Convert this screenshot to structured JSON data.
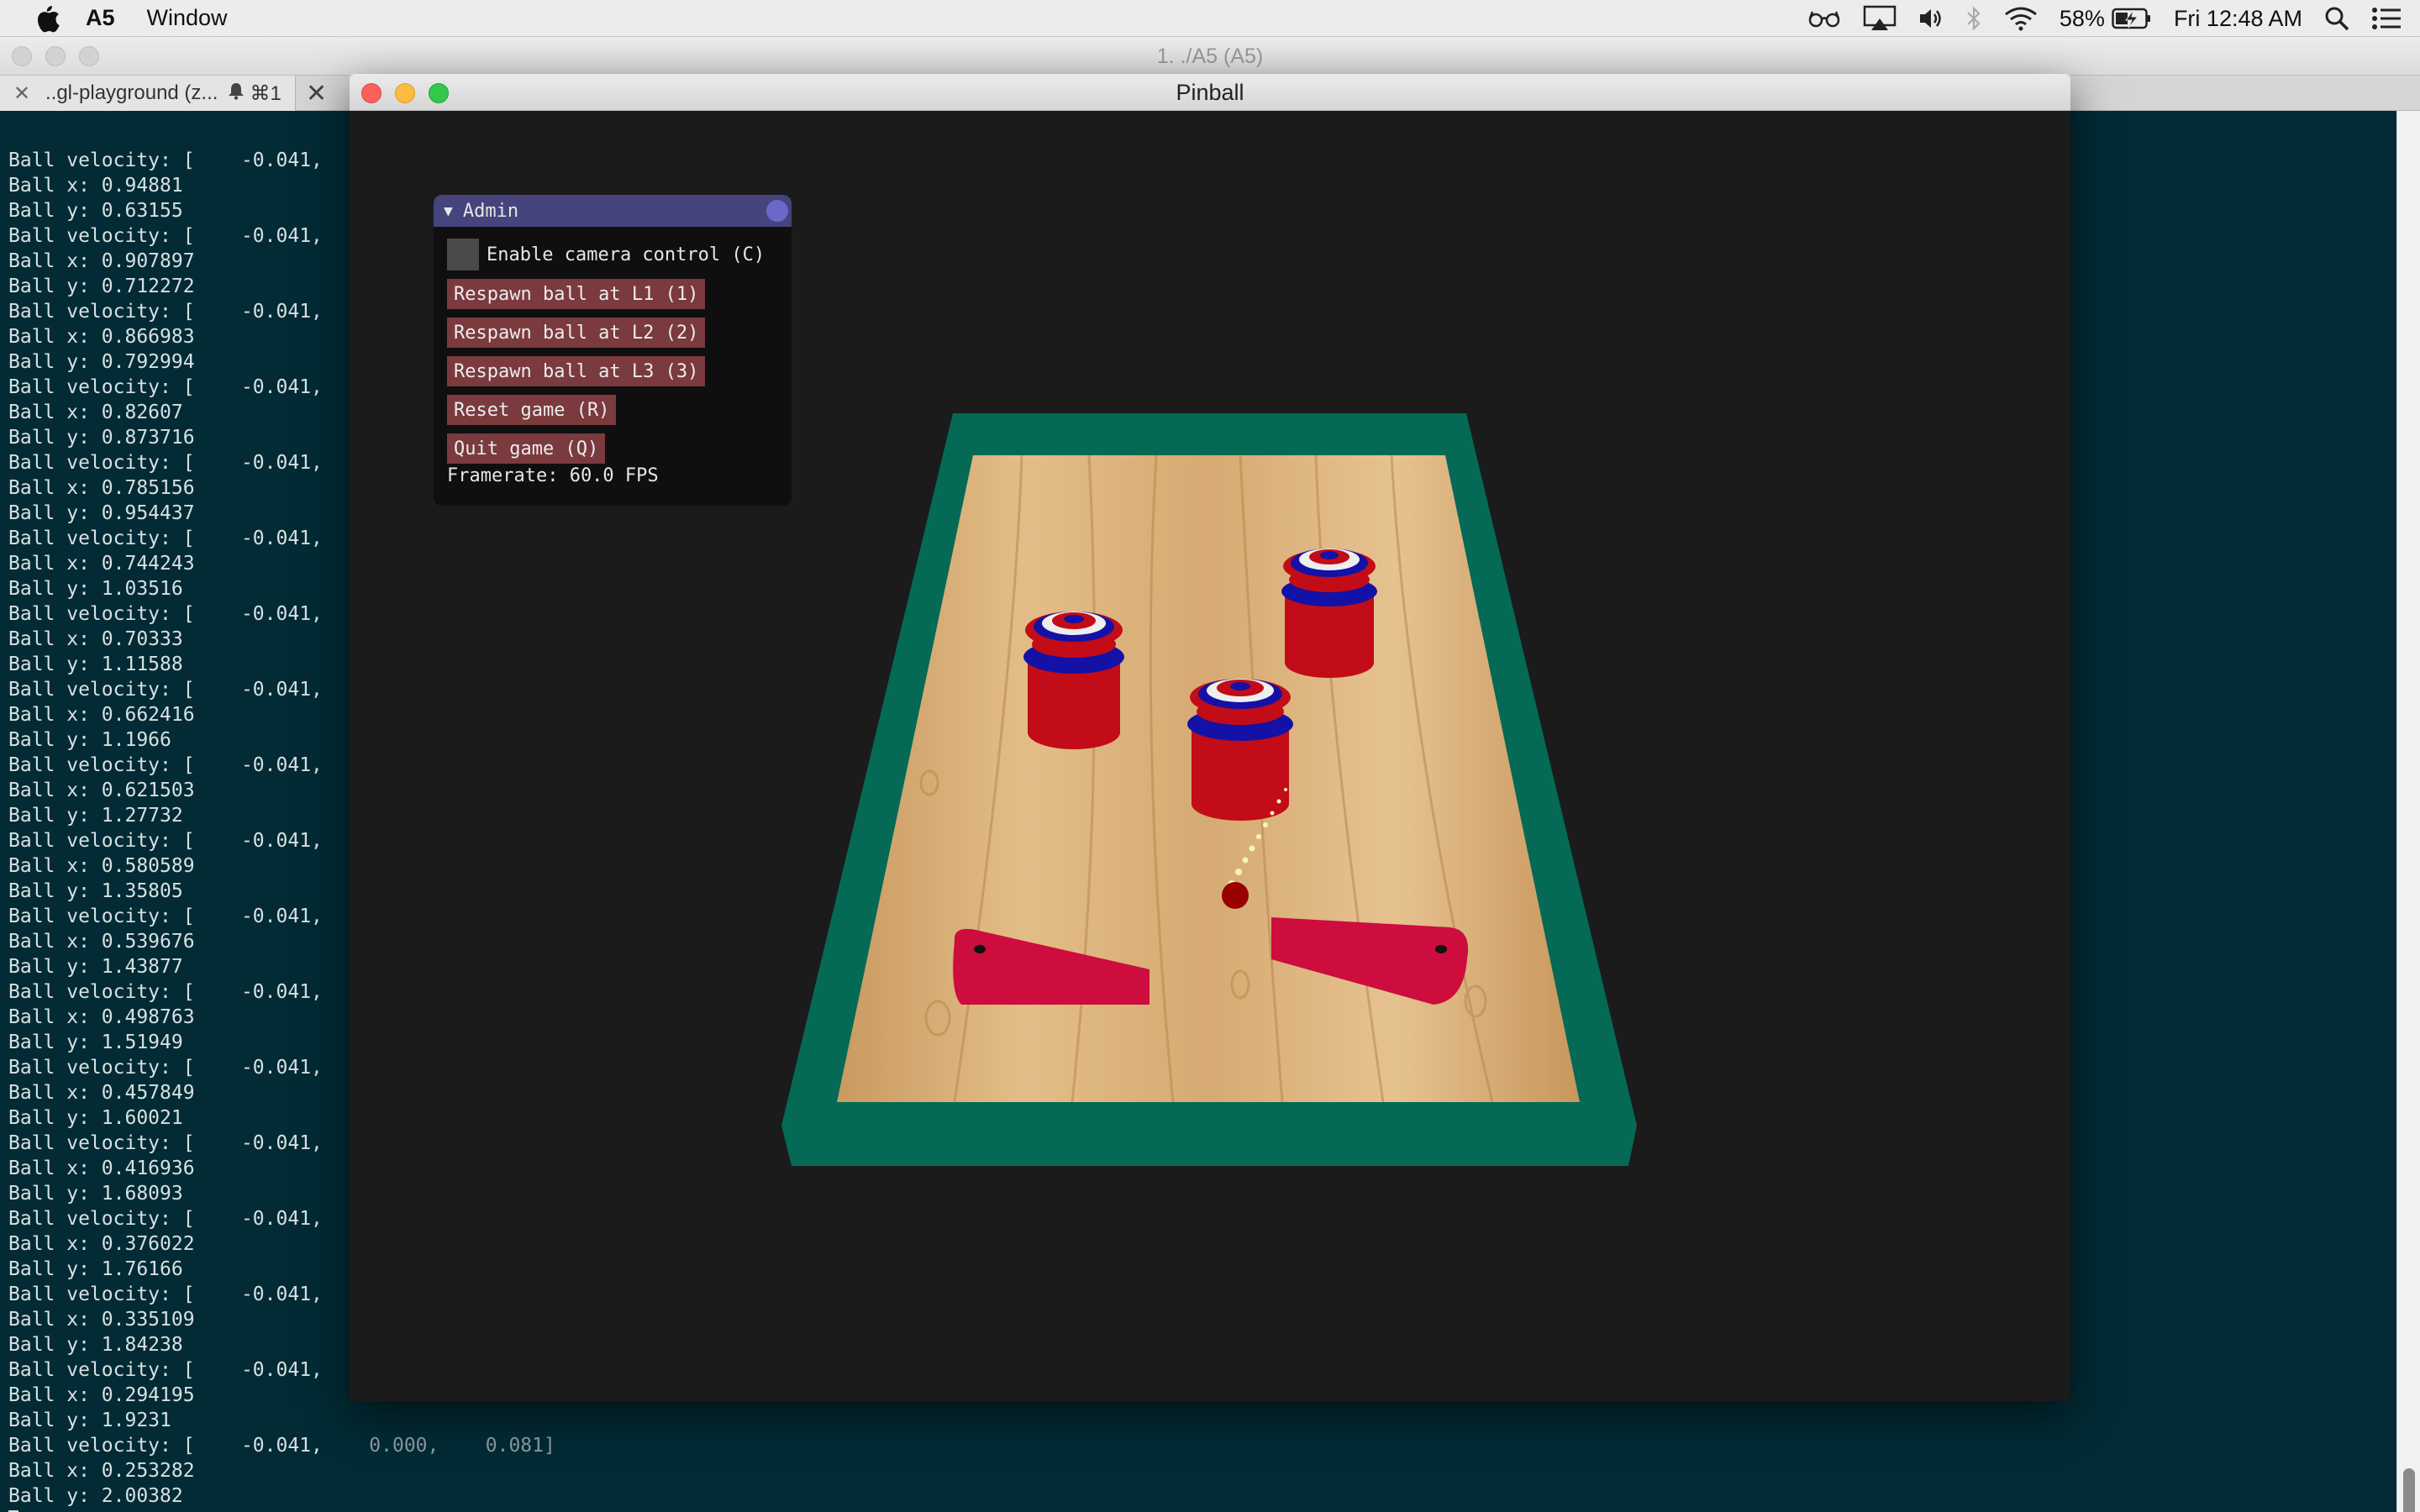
{
  "menubar": {
    "app_name": "A5",
    "menus": [
      "Window"
    ],
    "battery_percent": "58%",
    "clock": "Fri 12:48 AM",
    "icons": [
      "apple-icon",
      "glasses-icon",
      "airplay-icon",
      "volume-icon",
      "bluetooth-icon",
      "wifi-icon",
      "battery-charging-icon",
      "spotlight-search-icon",
      "notification-center-icon"
    ]
  },
  "terminal": {
    "window_title": "1. ./A5 (A5)",
    "tab_label": "..gl-playground (z...",
    "tab_shortcut": "⌘1",
    "log": [
      {
        "label": "Ball velocity: [",
        "value": "   -0.041,"
      },
      {
        "label": "Ball x:",
        "value": "0.94881"
      },
      {
        "label": "Ball y:",
        "value": "0.63155"
      },
      {
        "label": "Ball velocity: [",
        "value": "   -0.041,"
      },
      {
        "label": "Ball x:",
        "value": "0.907897"
      },
      {
        "label": "Ball y:",
        "value": "0.712272"
      },
      {
        "label": "Ball velocity: [",
        "value": "   -0.041,"
      },
      {
        "label": "Ball x:",
        "value": "0.866983"
      },
      {
        "label": "Ball y:",
        "value": "0.792994"
      },
      {
        "label": "Ball velocity: [",
        "value": "   -0.041,"
      },
      {
        "label": "Ball x:",
        "value": "0.82607"
      },
      {
        "label": "Ball y:",
        "value": "0.873716"
      },
      {
        "label": "Ball velocity: [",
        "value": "   -0.041,"
      },
      {
        "label": "Ball x:",
        "value": "0.785156"
      },
      {
        "label": "Ball y:",
        "value": "0.954437"
      },
      {
        "label": "Ball velocity: [",
        "value": "   -0.041,"
      },
      {
        "label": "Ball x:",
        "value": "0.744243"
      },
      {
        "label": "Ball y:",
        "value": "1.03516"
      },
      {
        "label": "Ball velocity: [",
        "value": "   -0.041,"
      },
      {
        "label": "Ball x:",
        "value": "0.70333"
      },
      {
        "label": "Ball y:",
        "value": "1.11588"
      },
      {
        "label": "Ball velocity: [",
        "value": "   -0.041,"
      },
      {
        "label": "Ball x:",
        "value": "0.662416"
      },
      {
        "label": "Ball y:",
        "value": "1.1966"
      },
      {
        "label": "Ball velocity: [",
        "value": "   -0.041,"
      },
      {
        "label": "Ball x:",
        "value": "0.621503"
      },
      {
        "label": "Ball y:",
        "value": "1.27732"
      },
      {
        "label": "Ball velocity: [",
        "value": "   -0.041,"
      },
      {
        "label": "Ball x:",
        "value": "0.580589"
      },
      {
        "label": "Ball y:",
        "value": "1.35805"
      },
      {
        "label": "Ball velocity: [",
        "value": "   -0.041,"
      },
      {
        "label": "Ball x:",
        "value": "0.539676"
      },
      {
        "label": "Ball y:",
        "value": "1.43877"
      },
      {
        "label": "Ball velocity: [",
        "value": "   -0.041,"
      },
      {
        "label": "Ball x:",
        "value": "0.498763"
      },
      {
        "label": "Ball y:",
        "value": "1.51949"
      },
      {
        "label": "Ball velocity: [",
        "value": "   -0.041,"
      },
      {
        "label": "Ball x:",
        "value": "0.457849"
      },
      {
        "label": "Ball y:",
        "value": "1.60021"
      },
      {
        "label": "Ball velocity: [",
        "value": "   -0.041,"
      },
      {
        "label": "Ball x:",
        "value": "0.416936"
      },
      {
        "label": "Ball y:",
        "value": "1.68093"
      },
      {
        "label": "Ball velocity: [",
        "value": "   -0.041,"
      },
      {
        "label": "Ball x:",
        "value": "0.376022"
      },
      {
        "label": "Ball y:",
        "value": "1.76166"
      },
      {
        "label": "Ball velocity: [",
        "value": "   -0.041,"
      },
      {
        "label": "Ball x:",
        "value": "0.335109"
      },
      {
        "label": "Ball y:",
        "value": "1.84238"
      },
      {
        "label": "Ball velocity: [",
        "value": "   -0.041,"
      },
      {
        "label": "Ball x:",
        "value": "0.294195"
      },
      {
        "label": "Ball y:",
        "value": "1.9231"
      },
      {
        "label": "Ball velocity: [",
        "value": "   -0.041,",
        "tail": "    0.000,    0.081]"
      },
      {
        "label": "Ball x:",
        "value": "0.253282"
      },
      {
        "label": "Ball y:",
        "value": "2.00382"
      }
    ]
  },
  "pinball": {
    "window_title": "Pinball",
    "colors": {
      "viewport_bg": "#1b1b1b",
      "border": "#046a55",
      "wood": "#dcb27c",
      "flipper": "#cc0d3e",
      "bumper_red": "#c20c17",
      "bumper_blue": "#1411a6",
      "ball": "#990000"
    },
    "admin": {
      "title": "Admin",
      "camera_checkbox_label": "Enable camera control (C)",
      "camera_checkbox_checked": false,
      "buttons": [
        {
          "label": "Respawn ball at L1 (1)"
        },
        {
          "label": "Respawn ball at L2 (2)"
        },
        {
          "label": "Respawn ball at L3 (3)"
        },
        {
          "label": "Reset game (R)"
        },
        {
          "label": "Quit game (Q)"
        }
      ],
      "framerate": "Framerate: 60.0 FPS"
    }
  }
}
